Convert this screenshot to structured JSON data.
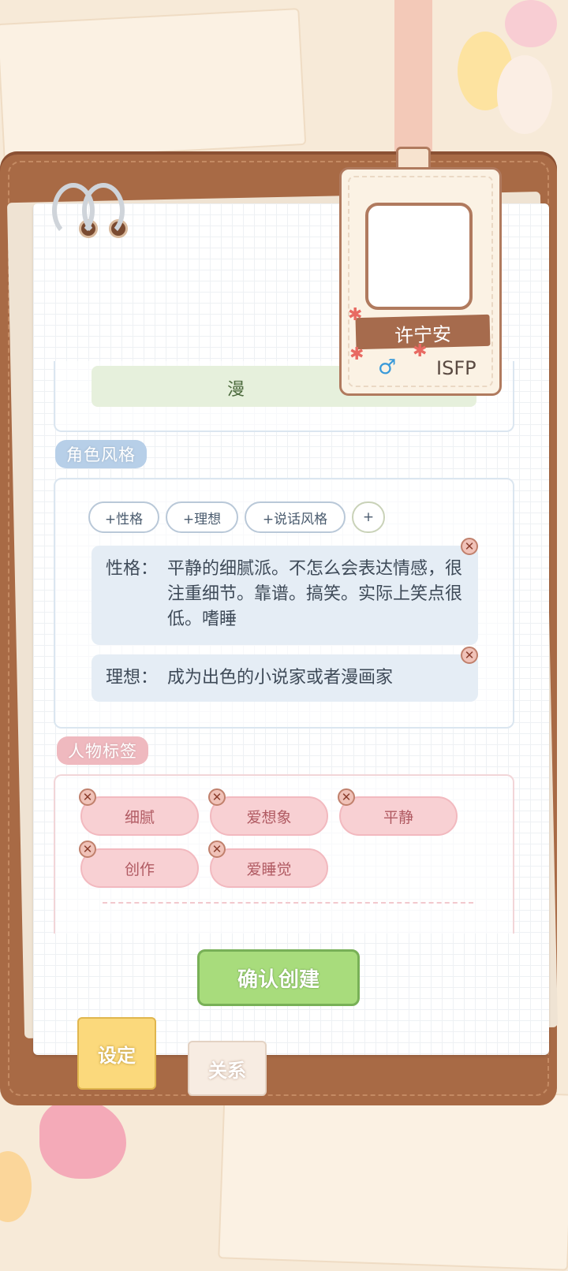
{
  "profile_card": {
    "name": "许宁安",
    "gender_symbol": "♂",
    "mbti": "ISFP"
  },
  "intro_section": {
    "visible_text": "漫"
  },
  "style_section": {
    "title": "角色风格",
    "add_buttons": [
      "+性格",
      "+理想",
      "+说话风格",
      "+"
    ],
    "traits": [
      {
        "label": "性格：",
        "text": "平静的细腻派。不怎么会表达情感，很注重细节。靠谱。搞笑。实际上笑点很低。嗜睡"
      },
      {
        "label": "理想：",
        "text": "成为出色的小说家或者漫画家"
      }
    ]
  },
  "tags_section": {
    "title": "人物标签",
    "tags": [
      "细腻",
      "爱想象",
      "平静",
      "创作",
      "爱睡觉"
    ]
  },
  "confirm_button": "确认创建",
  "bottom_tabs": [
    "设定",
    "关系"
  ],
  "colors": {
    "clipboard": "#a86a45",
    "confirm": "#a8dc7c",
    "tag_bg": "#f8d0d3",
    "trait_bg": "#e5edf5"
  }
}
